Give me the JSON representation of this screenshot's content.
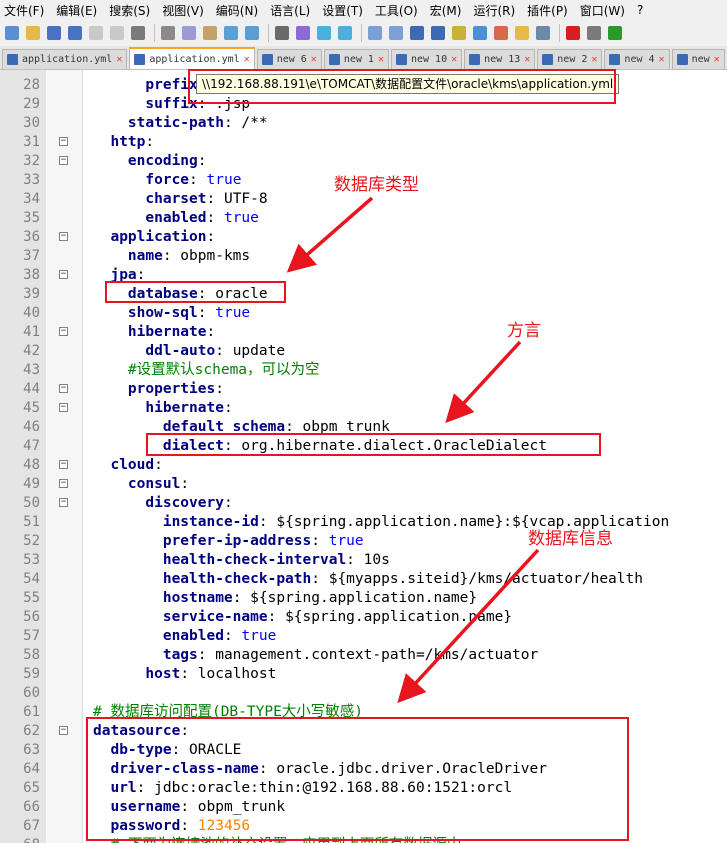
{
  "menu": [
    "文件(F)",
    "编辑(E)",
    "搜索(S)",
    "视图(V)",
    "编码(N)",
    "语言(L)",
    "设置(T)",
    "工具(O)",
    "宏(M)",
    "运行(R)",
    "插件(P)",
    "窗口(W)",
    "?"
  ],
  "toolbar_icons": [
    "new-file-icon",
    "open-file-icon",
    "save-icon",
    "save-all-icon",
    "close-icon",
    "close-all-icon",
    "print-icon",
    "cut-icon",
    "copy-icon",
    "paste-icon",
    "undo-icon",
    "redo-icon",
    "find-icon",
    "replace-icon",
    "zoom-in-icon",
    "zoom-out-icon",
    "sync-v-icon",
    "sync-h-icon",
    "word-wrap-icon",
    "show-all-chars-icon",
    "indent-guide-icon",
    "doc-map-icon",
    "function-list-icon",
    "folder-icon",
    "monitor-icon",
    "record-macro-icon",
    "stop-macro-icon",
    "play-macro-icon"
  ],
  "tabs": [
    {
      "label": "application.yml",
      "active": false
    },
    {
      "label": "application.yml",
      "active": true
    },
    {
      "label": "new 6",
      "active": false
    },
    {
      "label": "new 1",
      "active": false
    },
    {
      "label": "new 10",
      "active": false
    },
    {
      "label": "new 13",
      "active": false
    },
    {
      "label": "new 2",
      "active": false
    },
    {
      "label": "new 4",
      "active": false
    },
    {
      "label": "new",
      "active": false
    }
  ],
  "tooltip": "\\\\192.168.88.191\\e\\TOMCAT\\数据配置文件\\oracle\\kms\\application.yml",
  "lines": [
    {
      "n": "28",
      "fold": "",
      "seg": [
        [
          "      ",
          ""
        ],
        [
          "prefix",
          "k"
        ]
      ]
    },
    {
      "n": "29",
      "fold": "",
      "seg": [
        [
          "      ",
          ""
        ],
        [
          "suffix",
          "k"
        ],
        [
          ": .jsp",
          "v"
        ]
      ]
    },
    {
      "n": "30",
      "fold": "",
      "seg": [
        [
          "    ",
          ""
        ],
        [
          "static-path",
          "k"
        ],
        [
          ": /**",
          "v"
        ]
      ]
    },
    {
      "n": "31",
      "fold": "-",
      "seg": [
        [
          "  ",
          ""
        ],
        [
          "http",
          "k"
        ],
        [
          ":",
          "v"
        ]
      ]
    },
    {
      "n": "32",
      "fold": "-",
      "seg": [
        [
          "    ",
          ""
        ],
        [
          "encoding",
          "k"
        ],
        [
          ":",
          "v"
        ]
      ]
    },
    {
      "n": "33",
      "fold": "",
      "seg": [
        [
          "      ",
          ""
        ],
        [
          "force",
          "k"
        ],
        [
          ": ",
          "v"
        ],
        [
          "true",
          "b"
        ]
      ]
    },
    {
      "n": "34",
      "fold": "",
      "seg": [
        [
          "      ",
          ""
        ],
        [
          "charset",
          "k"
        ],
        [
          ": UTF-8",
          "v"
        ]
      ]
    },
    {
      "n": "35",
      "fold": "",
      "seg": [
        [
          "      ",
          ""
        ],
        [
          "enabled",
          "k"
        ],
        [
          ": ",
          "v"
        ],
        [
          "true",
          "b"
        ]
      ]
    },
    {
      "n": "36",
      "fold": "-",
      "seg": [
        [
          "  ",
          ""
        ],
        [
          "application",
          "k"
        ],
        [
          ":",
          "v"
        ]
      ]
    },
    {
      "n": "37",
      "fold": "",
      "seg": [
        [
          "    ",
          ""
        ],
        [
          "name",
          "k"
        ],
        [
          ": obpm-kms",
          "v"
        ]
      ]
    },
    {
      "n": "38",
      "fold": "-",
      "seg": [
        [
          "  ",
          ""
        ],
        [
          "jpa",
          "k"
        ],
        [
          ":",
          "v"
        ]
      ]
    },
    {
      "n": "39",
      "fold": "",
      "seg": [
        [
          "    ",
          ""
        ],
        [
          "database",
          "k"
        ],
        [
          ": oracle",
          "v"
        ]
      ]
    },
    {
      "n": "40",
      "fold": "",
      "seg": [
        [
          "    ",
          ""
        ],
        [
          "show-sql",
          "k"
        ],
        [
          ": ",
          "v"
        ],
        [
          "true",
          "b"
        ]
      ]
    },
    {
      "n": "41",
      "fold": "-",
      "seg": [
        [
          "    ",
          ""
        ],
        [
          "hibernate",
          "k"
        ],
        [
          ":",
          "v"
        ]
      ]
    },
    {
      "n": "42",
      "fold": "",
      "seg": [
        [
          "      ",
          ""
        ],
        [
          "ddl-auto",
          "k"
        ],
        [
          ": update",
          "v"
        ]
      ]
    },
    {
      "n": "43",
      "fold": "",
      "seg": [
        [
          "    ",
          ""
        ],
        [
          "#设置默认schema，可以为空",
          "c"
        ]
      ]
    },
    {
      "n": "44",
      "fold": "-",
      "seg": [
        [
          "    ",
          ""
        ],
        [
          "properties",
          "k"
        ],
        [
          ":",
          "v"
        ]
      ]
    },
    {
      "n": "45",
      "fold": "-",
      "seg": [
        [
          "      ",
          ""
        ],
        [
          "hibernate",
          "k"
        ],
        [
          ":",
          "v"
        ]
      ]
    },
    {
      "n": "46",
      "fold": "",
      "seg": [
        [
          "        ",
          ""
        ],
        [
          "default_schema",
          "k"
        ],
        [
          ": obpm_trunk",
          "v"
        ]
      ]
    },
    {
      "n": "47",
      "fold": "",
      "seg": [
        [
          "        ",
          ""
        ],
        [
          "dialect",
          "k"
        ],
        [
          ": org.hibernate.dialect.OracleDialect",
          "v"
        ]
      ]
    },
    {
      "n": "48",
      "fold": "-",
      "seg": [
        [
          "  ",
          ""
        ],
        [
          "cloud",
          "k"
        ],
        [
          ":",
          "v"
        ]
      ]
    },
    {
      "n": "49",
      "fold": "-",
      "seg": [
        [
          "    ",
          ""
        ],
        [
          "consul",
          "k"
        ],
        [
          ":",
          "v"
        ]
      ]
    },
    {
      "n": "50",
      "fold": "-",
      "seg": [
        [
          "      ",
          ""
        ],
        [
          "discovery",
          "k"
        ],
        [
          ":",
          "v"
        ]
      ]
    },
    {
      "n": "51",
      "fold": "",
      "seg": [
        [
          "        ",
          ""
        ],
        [
          "instance-id",
          "k"
        ],
        [
          ": ${spring.application.name}:${vcap.application",
          "v"
        ]
      ]
    },
    {
      "n": "52",
      "fold": "",
      "seg": [
        [
          "        ",
          ""
        ],
        [
          "prefer-ip-address",
          "k"
        ],
        [
          ": ",
          "v"
        ],
        [
          "true",
          "b"
        ]
      ]
    },
    {
      "n": "53",
      "fold": "",
      "seg": [
        [
          "        ",
          ""
        ],
        [
          "health-check-interval",
          "k"
        ],
        [
          ": 10s",
          "v"
        ]
      ]
    },
    {
      "n": "54",
      "fold": "",
      "seg": [
        [
          "        ",
          ""
        ],
        [
          "health-check-path",
          "k"
        ],
        [
          ": ${myapps.siteid}/kms/actuator/health",
          "v"
        ]
      ]
    },
    {
      "n": "55",
      "fold": "",
      "seg": [
        [
          "        ",
          ""
        ],
        [
          "hostname",
          "k"
        ],
        [
          ": ${spring.application.name}",
          "v"
        ]
      ]
    },
    {
      "n": "56",
      "fold": "",
      "seg": [
        [
          "        ",
          ""
        ],
        [
          "service-name",
          "k"
        ],
        [
          ": ${spring.application.name}",
          "v"
        ]
      ]
    },
    {
      "n": "57",
      "fold": "",
      "seg": [
        [
          "        ",
          ""
        ],
        [
          "enabled",
          "k"
        ],
        [
          ": ",
          "v"
        ],
        [
          "true",
          "b"
        ]
      ]
    },
    {
      "n": "58",
      "fold": "",
      "seg": [
        [
          "        ",
          ""
        ],
        [
          "tags",
          "k"
        ],
        [
          ": management.context-path=/kms/actuator",
          "v"
        ]
      ]
    },
    {
      "n": "59",
      "fold": "",
      "seg": [
        [
          "      ",
          ""
        ],
        [
          "host",
          "k"
        ],
        [
          ": localhost",
          "v"
        ]
      ]
    },
    {
      "n": "60",
      "fold": "",
      "seg": []
    },
    {
      "n": "61",
      "fold": "",
      "seg": [
        [
          "# 数据库访问配置(DB-TYPE大小写敏感)",
          "c"
        ]
      ]
    },
    {
      "n": "62",
      "fold": "-",
      "seg": [
        [
          "datasource",
          "k"
        ],
        [
          ":",
          "v"
        ]
      ]
    },
    {
      "n": "63",
      "fold": "",
      "seg": [
        [
          "  ",
          ""
        ],
        [
          "db-type",
          "k"
        ],
        [
          ": ORACLE",
          "v"
        ]
      ]
    },
    {
      "n": "64",
      "fold": "",
      "seg": [
        [
          "  ",
          ""
        ],
        [
          "driver-class-name",
          "k"
        ],
        [
          ": oracle.jdbc.driver.OracleDriver",
          "v"
        ]
      ]
    },
    {
      "n": "65",
      "fold": "",
      "seg": [
        [
          "  ",
          ""
        ],
        [
          "url",
          "k"
        ],
        [
          ": jdbc:oracle:thin:@192.168.88.60:1521:orcl",
          "v"
        ]
      ]
    },
    {
      "n": "66",
      "fold": "",
      "seg": [
        [
          "  ",
          ""
        ],
        [
          "username",
          "k"
        ],
        [
          ": obpm_trunk",
          "v"
        ]
      ]
    },
    {
      "n": "67",
      "fold": "",
      "seg": [
        [
          "  ",
          ""
        ],
        [
          "password",
          "k"
        ],
        [
          ": ",
          "v"
        ],
        [
          "123456",
          "n"
        ]
      ]
    },
    {
      "n": "68",
      "fold": "",
      "seg": [
        [
          "  ",
          ""
        ],
        [
          "# 下面为连接池的补充设置，应用到上面所有数据源中",
          "c"
        ]
      ]
    }
  ],
  "annotations": {
    "db_type": "数据库类型",
    "dialect": "方言",
    "db_info": "数据库信息"
  },
  "colors": {
    "highlight": "#e8141e",
    "key": "#000080",
    "comment": "#008000",
    "bool": "#0000ff",
    "number": "#ff8000"
  }
}
